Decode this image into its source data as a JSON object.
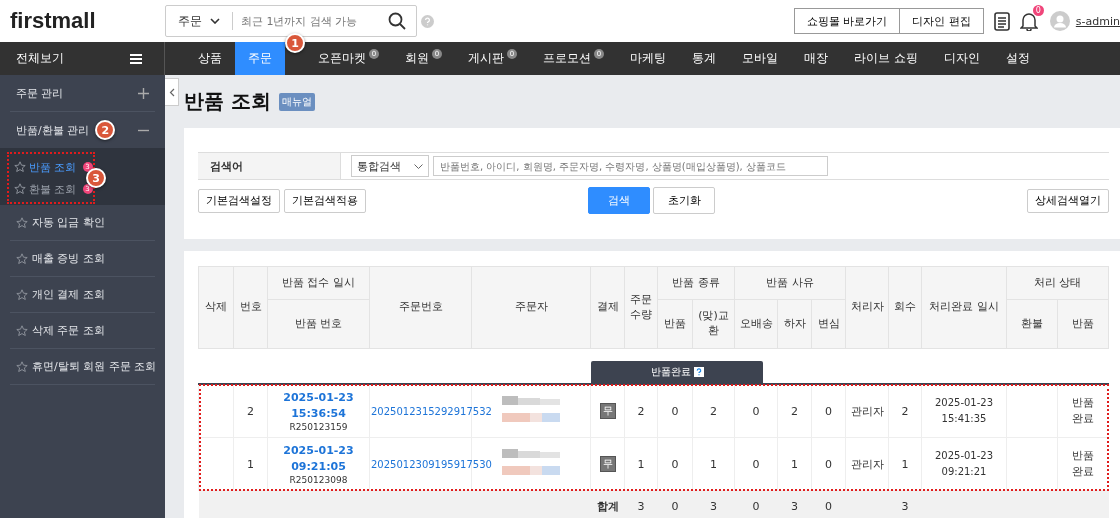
{
  "header": {
    "logo": "firstmall",
    "search": {
      "scope": "주문",
      "placeholder": "최근 1년까지 검색 가능"
    },
    "buttons": [
      "쇼핑몰 바로가기",
      "디자인 편집"
    ],
    "notification_count": "0",
    "user": "s-admin"
  },
  "nav": {
    "all_label": "전체보기",
    "tabs": [
      {
        "label": "상품",
        "selected": false
      },
      {
        "label": "주문",
        "selected": true,
        "marker": "1"
      },
      {
        "label": "오픈마켓",
        "selected": false,
        "count": "0"
      },
      {
        "label": "회원",
        "selected": false,
        "count": "0"
      },
      {
        "label": "게시판",
        "selected": false,
        "count": "0"
      },
      {
        "label": "프로모션",
        "selected": false,
        "count": "0"
      },
      {
        "label": "마케팅",
        "selected": false
      },
      {
        "label": "통계",
        "selected": false
      },
      {
        "label": "모바일",
        "selected": false
      },
      {
        "label": "매장",
        "selected": false
      },
      {
        "label": "라이브 쇼핑",
        "selected": false
      },
      {
        "label": "디자인",
        "selected": false
      },
      {
        "label": "설정",
        "selected": false
      }
    ]
  },
  "sidebar": {
    "groups": [
      {
        "label": "주문 관리",
        "expanded": false
      },
      {
        "label": "반품/환불 관리",
        "expanded": true,
        "marker": "2",
        "children_marker": "3",
        "children_highlighted": true,
        "children": [
          {
            "label": "반품 조회",
            "selected": true,
            "count": "3"
          },
          {
            "label": "환불 조회",
            "selected": false,
            "count": "3"
          }
        ]
      }
    ],
    "items": [
      "자동 입금 확인",
      "매출 증빙 조회",
      "개인 결제 조회",
      "삭제 주문 조회",
      "휴면/탈퇴 회원 주문 조회"
    ]
  },
  "page": {
    "title": "반품 조회",
    "manual_badge": "매뉴얼"
  },
  "search_form": {
    "label": "검색어",
    "type_select": "통합검색",
    "placeholder": "반품번호, 아이디, 회원명, 주문자명, 수령자명, 상품명(매입상품명), 상품코드",
    "left_buttons": [
      "기본검색설정",
      "기본검색적용"
    ],
    "main_buttons": [
      {
        "label": "검색",
        "kind": "primary"
      },
      {
        "label": "초기화",
        "kind": "default"
      }
    ],
    "right_button": "상세검색열기"
  },
  "table": {
    "columns": [
      {
        "label": "삭제"
      },
      {
        "label": "번호"
      },
      {
        "label": "반품 접수 일시",
        "stacked": "반품 번호"
      },
      {
        "label": "주문번호"
      },
      {
        "label": "주문자"
      },
      {
        "label": "결제"
      },
      {
        "label": "주문수량"
      },
      {
        "label": "반품 종류",
        "sub": [
          "반품",
          "(맞)교환"
        ]
      },
      {
        "label": "반품 사유",
        "sub": [
          "오배송",
          "하자",
          "변심"
        ]
      },
      {
        "label": "처리자"
      },
      {
        "label": "회수"
      },
      {
        "label": "처리완료 일시"
      },
      {
        "label": "처리 상태",
        "sub": [
          "환불",
          "반품"
        ]
      }
    ],
    "status_tab": "반품완료",
    "rows_highlighted": true,
    "rows": [
      {
        "no": "2",
        "received": "2025-01-23 15:36:54",
        "return_no": "R250123159",
        "order_no": "2025012315292917532",
        "payment": "무",
        "qty": "2",
        "type_return": "0",
        "type_exchange": "2",
        "reason_wrong": "0",
        "reason_defect": "2",
        "reason_change": "0",
        "handler": "관리자",
        "count": "2",
        "done": "2025-01-23 15:41:35",
        "return_status": "반품 완료"
      },
      {
        "no": "1",
        "received": "2025-01-23 09:21:05",
        "return_no": "R250123098",
        "order_no": "2025012309195917530",
        "payment": "무",
        "qty": "1",
        "type_return": "0",
        "type_exchange": "1",
        "reason_wrong": "0",
        "reason_defect": "1",
        "reason_change": "0",
        "handler": "관리자",
        "count": "1",
        "done": "2025-01-23 09:21:21",
        "return_status": "반품 완료"
      }
    ],
    "totals": {
      "label": "합계",
      "qty": "3",
      "type_return": "0",
      "type_exchange": "3",
      "reason_wrong": "0",
      "reason_defect": "3",
      "reason_change": "0",
      "count": "3"
    }
  }
}
